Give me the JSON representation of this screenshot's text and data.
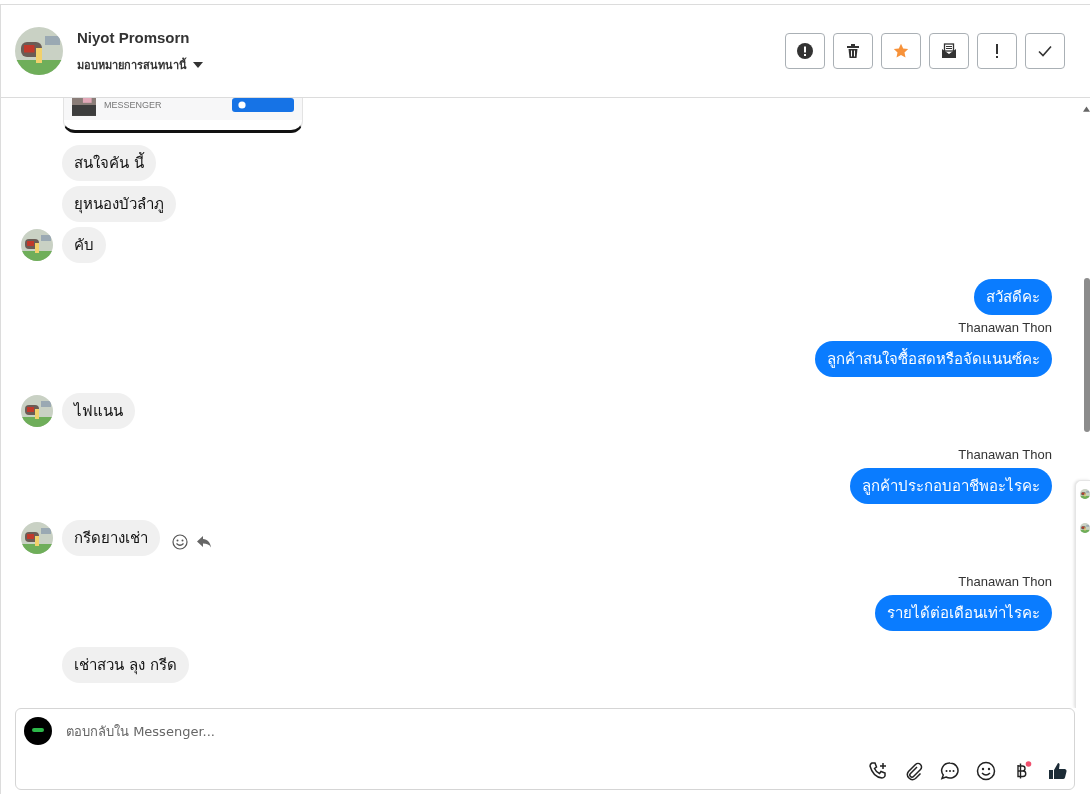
{
  "header": {
    "name": "Niyot Promsorn",
    "assign_label": "มอบหมายการสนทนานี้"
  },
  "shared_card": {
    "caption": "MESSENGER"
  },
  "messages": [
    {
      "kind": "incoming",
      "text": "สนใจคัน นี้",
      "avatar": false,
      "actions": false
    },
    {
      "kind": "incoming",
      "text": "ยุหนองบัวลำภู",
      "avatar": false,
      "actions": false
    },
    {
      "kind": "incoming",
      "text": "คับ",
      "avatar": true,
      "actions": false
    },
    {
      "kind": "outgoing",
      "text": "สวัสดีคะ"
    },
    {
      "kind": "outgoing",
      "sender": "Thanawan Thon",
      "text": "ลูกค้าสนใจซื้อสดหรือจัดแนนซ์คะ"
    },
    {
      "kind": "incoming",
      "text": "ไฟแนน",
      "avatar": true,
      "actions": false
    },
    {
      "kind": "outgoing",
      "sender": "Thanawan Thon",
      "text": "ลูกค้าประกอบอาชีพอะไรคะ"
    },
    {
      "kind": "incoming",
      "text": "กรีดยางเช่า",
      "avatar": true,
      "actions": true
    },
    {
      "kind": "outgoing",
      "sender": "Thanawan Thon",
      "text": "รายได้ต่อเดือนเท่าไรคะ"
    },
    {
      "kind": "incoming",
      "text": "เช่าสวน ลุง กรีด",
      "avatar": false,
      "actions": false
    }
  ],
  "composer": {
    "placeholder": "ตอบกลับใน Messenger...",
    "payment_badge": true
  }
}
